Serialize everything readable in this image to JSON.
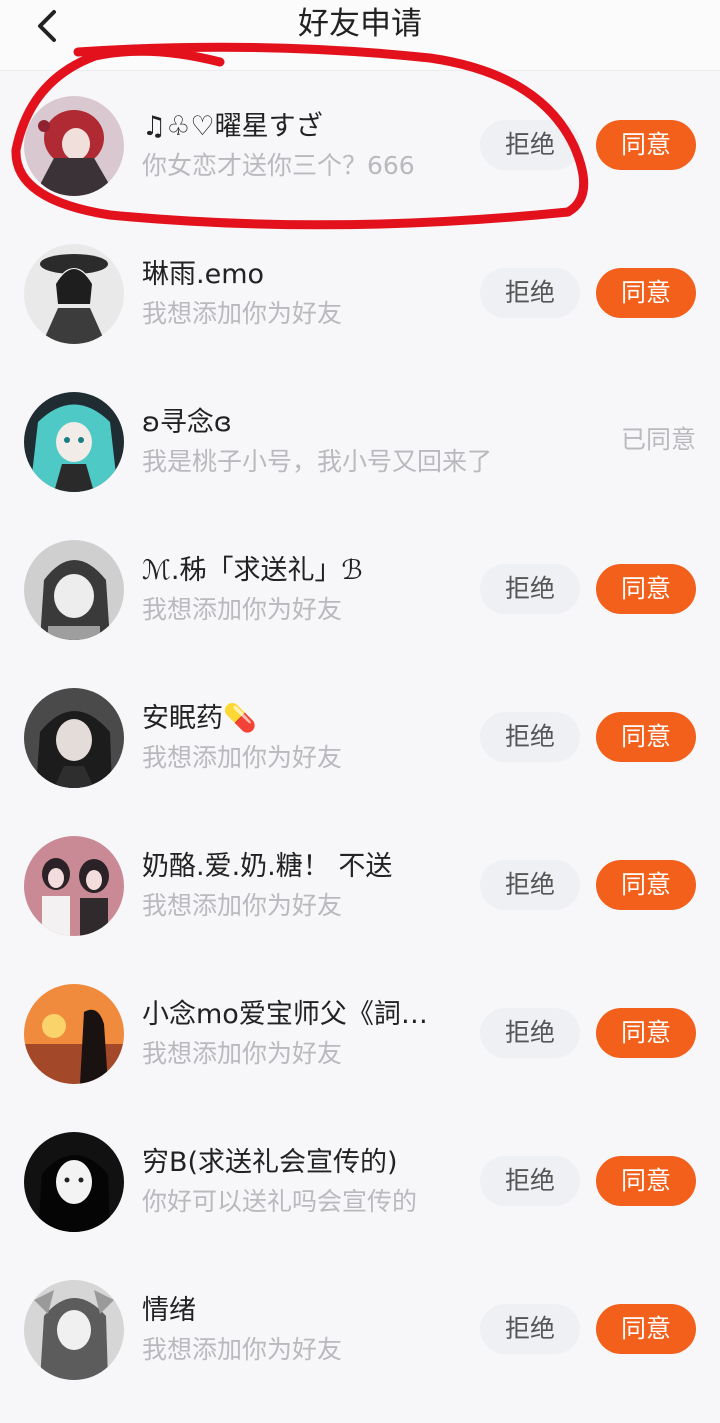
{
  "header": {
    "title": "好友申请",
    "back_icon": "chevron-left-icon"
  },
  "buttons": {
    "reject": "拒绝",
    "agree": "同意"
  },
  "colors": {
    "accent": "#f2601c",
    "reject_bg": "#eef0f4",
    "annotation": "#e3111b"
  },
  "requests": [
    {
      "name": "♫♧♡曜星すざ",
      "message": "你女恋才送你三个？666",
      "status": "pending"
    },
    {
      "name": "琳雨.emo",
      "message": "我想添加你为好友",
      "status": "pending"
    },
    {
      "name": "ʚ寻念ɞ",
      "message": "我是桃子小号，我小号又回来了",
      "status": "agreed",
      "status_text": "已同意"
    },
    {
      "name": "ℳ.秭「求送礼」ℬ",
      "message": "我想添加你为好友",
      "status": "pending"
    },
    {
      "name": "安眠药💊",
      "message": "我想添加你为好友",
      "status": "pending"
    },
    {
      "name": "奶酪.爱.奶.糖！ 不送",
      "message": "我想添加你为好友",
      "status": "pending"
    },
    {
      "name": "小念mo爱宝师父《詞…",
      "message": "我想添加你为好友",
      "status": "pending"
    },
    {
      "name": "穷B(求送礼会宣传的)",
      "message": "你好可以送礼吗会宣传的",
      "status": "pending"
    },
    {
      "name": "情绪",
      "message": "我想添加你为好友",
      "status": "pending"
    }
  ]
}
